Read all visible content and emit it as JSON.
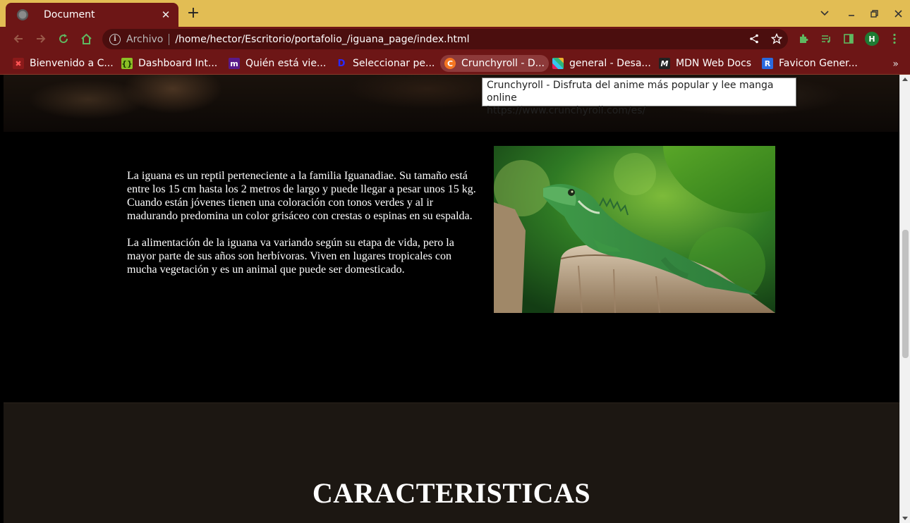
{
  "tab": {
    "title": "Document"
  },
  "toolbar": {
    "scheme_label": "Archivo",
    "url": "/home/hector/Escritorio/portafolio_/iguana_page/index.html",
    "profile_initial": "H"
  },
  "bookmarks": [
    {
      "label": "Bienvenido a C..."
    },
    {
      "label": "Dashboard Int..."
    },
    {
      "label": "Quién está vie..."
    },
    {
      "label": "Seleccionar pe..."
    },
    {
      "label": "Crunchyroll - D..."
    },
    {
      "label": "general - Desa..."
    },
    {
      "label": "MDN Web Docs"
    },
    {
      "label": "Favicon Gener..."
    }
  ],
  "bookmarks_more": "»",
  "tooltip": {
    "line1": "Crunchyroll - Disfruta del anime más popular y lee manga online",
    "line2": "https://www.crunchyroll.com/es/"
  },
  "page": {
    "paragraph1": "La iguana es un reptil perteneciente a la familia Iguanadiae. Su tamaño está entre los 15 cm hasta los 2 metros de largo y puede llegar a pesar unos 15 kg. Cuando están jóvenes tienen una coloración con tonos verdes y al ir madurando predomina un color grisáceo con crestas o espinas en su espalda.",
    "paragraph2": "La alimentación de la iguana va variando según su etapa de vida, pero la mayor parte de sus años son herbívoras. Viven en lugares tropicales con mucha vegetación y es un animal que puede ser domesticado.",
    "features_title": "CARACTERISTICAS"
  },
  "colors": {
    "frame": "#e2bd54",
    "toolbar": "#6d1616",
    "omnibox": "#4b0e0e"
  }
}
